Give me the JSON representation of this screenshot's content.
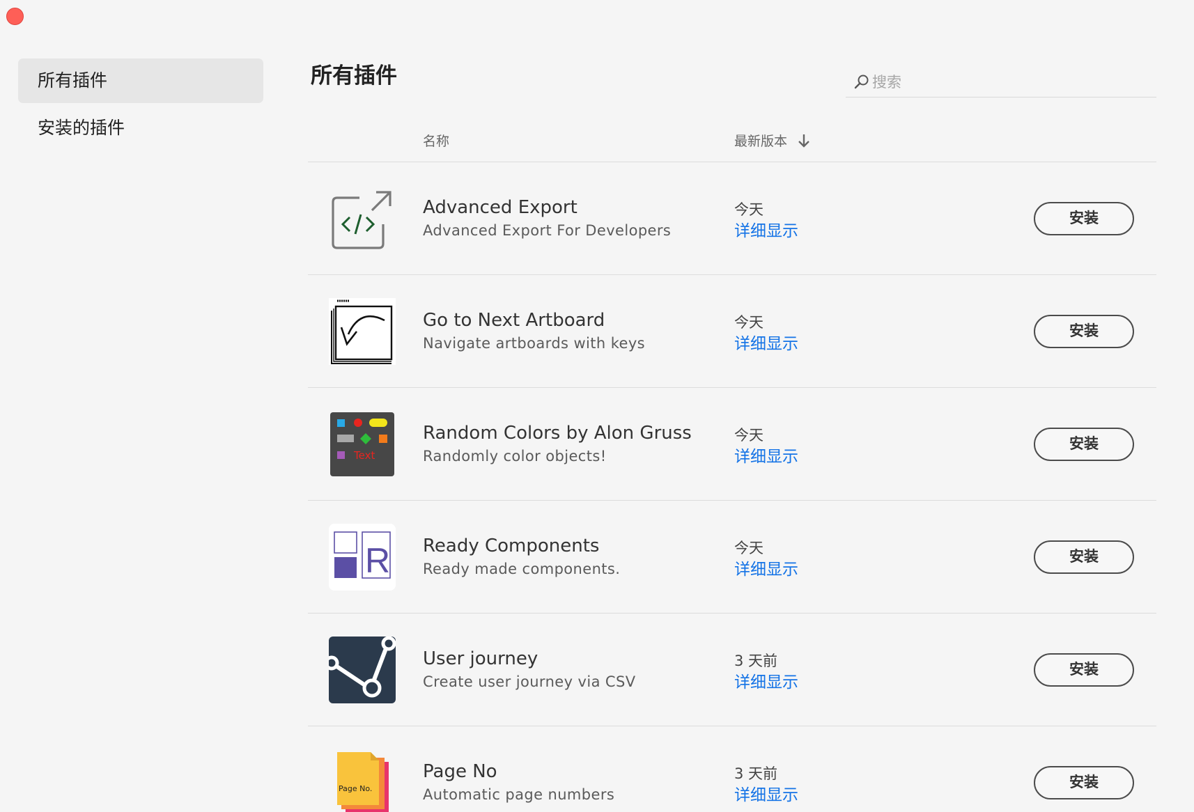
{
  "window": {
    "close_color": "#fe5f57"
  },
  "sidebar": {
    "items": [
      {
        "label": "所有插件",
        "active": true
      },
      {
        "label": "安装的插件",
        "active": false
      }
    ]
  },
  "main": {
    "title": "所有插件",
    "search": {
      "placeholder": "搜索",
      "icon": "search-icon"
    },
    "columns": {
      "name": "名称",
      "version": "最新版本",
      "sort_icon": "arrow-down-icon"
    }
  },
  "plugins": [
    {
      "name": "Advanced Export",
      "description": "Advanced Export For Developers",
      "date": "今天",
      "detail": "详细显示",
      "action": "安装",
      "icon": "export-code-icon"
    },
    {
      "name": "Go to Next Artboard",
      "description": "Navigate artboards with keys",
      "date": "今天",
      "detail": "详细显示",
      "action": "安装",
      "icon": "artboard-arrow-icon"
    },
    {
      "name": "Random Colors by Alon Gruss",
      "description": "Randomly color objects!",
      "date": "今天",
      "detail": "详细显示",
      "action": "安装",
      "icon": "random-colors-icon",
      "icon_text": "Text"
    },
    {
      "name": "Ready Components",
      "description": "Ready made components.",
      "date": "今天",
      "detail": "详细显示",
      "action": "安装",
      "icon": "ready-components-icon",
      "icon_text": "R"
    },
    {
      "name": "User journey",
      "description": "Create user journey via CSV",
      "date": "3 天前",
      "detail": "详细显示",
      "action": "安装",
      "icon": "user-journey-icon"
    },
    {
      "name": "Page No",
      "description": "Automatic page numbers",
      "date": "3 天前",
      "detail": "详细显示",
      "action": "安装",
      "icon": "page-no-icon",
      "icon_text": "Page No."
    }
  ],
  "colors": {
    "link": "#1473e6",
    "accent_button_border": "#4b4b4b"
  }
}
